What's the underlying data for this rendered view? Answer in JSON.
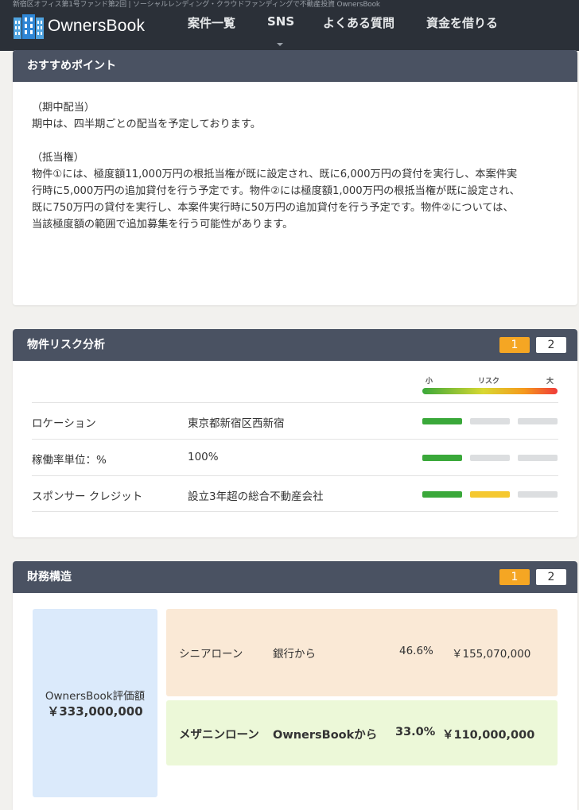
{
  "header": {
    "tagline": "新宿区オフィス第1号ファンド第2回 | ソーシャルレンディング・クラウドファンディングで不動産投資 OwnersBook",
    "logo_text": "OwnersBook",
    "nav": [
      "案件一覧",
      "SNS",
      "よくある質問",
      "資金を借りる"
    ]
  },
  "recommend": {
    "title": "おすすめポイント",
    "paragraphs": [
      [
        "（期中配当）",
        "期中は、四半期ごとの配当を予定しております。"
      ],
      [
        "（抵当権）",
        "物件①には、極度額11,000万円の根抵当権が既に設定され、既に6,000万円の貸付を実行し、本案件実",
        "行時に5,000万円の追加貸付を行う予定です。物件②には極度額1,000万円の根抵当権が既に設定され、",
        "既に750万円の貸付を実行し、本案件実行時に50万円の追加貸付を行う予定です。物件②については、",
        "当該極度額の範囲で追加募集を行う可能性があります。"
      ]
    ]
  },
  "risk": {
    "title": "物件リスク分析",
    "pages": [
      "1",
      "2"
    ],
    "scale": {
      "low": "小",
      "mid": "リスク",
      "high": "大"
    },
    "rows": [
      {
        "label": "ロケーション",
        "value": "東京都新宿区西新宿",
        "level": 1,
        "color": "#3aa83a"
      },
      {
        "label": "稼働率単位：%",
        "value": "100%",
        "level": 1,
        "color": "#3aa83a"
      },
      {
        "label": "スポンサー クレジット",
        "value": "設立3年超の総合不動産会社",
        "level": 2,
        "color": "#f5c830"
      }
    ]
  },
  "finance": {
    "title": "財務構造",
    "pages": [
      "1",
      "2"
    ],
    "valuation_label": "OwnersBook評価額",
    "valuation_value": "￥333,000,000",
    "senior": {
      "name": "シニアローン",
      "source": "銀行から",
      "pct": "46.6%",
      "amount": "￥155,070,000"
    },
    "mezzanine": {
      "name": "メザニンローン",
      "source": "OwnersBookから",
      "pct": "33.0%",
      "amount": "￥110,000,000"
    }
  },
  "colors": {
    "header_bg": "#2b3038",
    "card_head": "#4a5262",
    "accent": "#f5a623"
  }
}
